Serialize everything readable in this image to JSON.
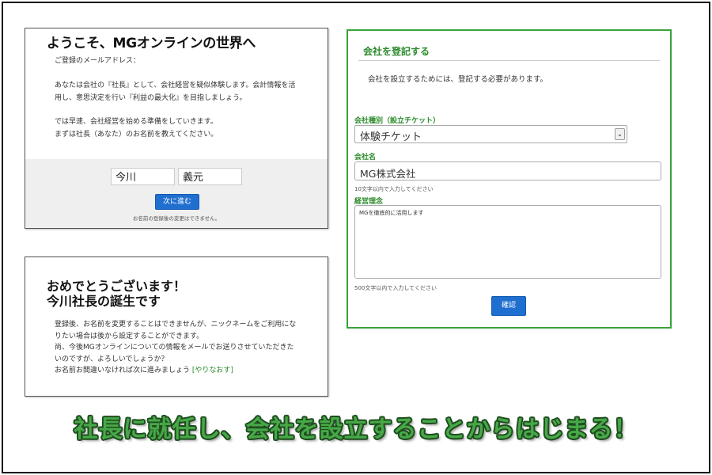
{
  "colors": {
    "accent_green": "#2a8a2a",
    "button_blue": "#1f6fd0",
    "caption_green": "#47a847",
    "caption_outline": "#1f4d1f"
  },
  "welcome": {
    "title": "ようこそ、MGオンラインの世界へ",
    "email_label": "ご登録のメールアドレス：",
    "intro_line1": "あなたは会社の『社長』として、会社経営を疑似体験します。会計情報を活",
    "intro_line2": "用し、意思決定を行い『利益の最大化』を目指しましょう。",
    "prep_line1": "では早速、会社経営を始める準備をしていきます。",
    "prep_line2": "まずは社長（あなた）のお名前を教えてください。",
    "last_name": "今川",
    "first_name": "義元",
    "next_label": "次に進む",
    "name_note": "お名前の登録後の変更はできません。"
  },
  "congrats": {
    "title_line1": "おめでとうございます！",
    "title_line2": "今川社長の誕生です",
    "line1": "登録後、お名前を変更することはできませんが、ニックネームをご利用にな",
    "line2": "りたい場合は後から設定することができます。",
    "line3": "尚、今後MGオンラインについての情報をメールでお送りさせていただきた",
    "line4": "いのですが、よろしいでしょうか？",
    "line5_prefix": "お名前お間違いなければ次に進みましょう",
    "redo_link": "[やりなおす]"
  },
  "company": {
    "heading": "会社を登記する",
    "intro": "会社を設立するためには、登記する必要があります。",
    "type_label": "会社種別（設立チケット）",
    "type_value": "体験チケット",
    "name_label": "会社名",
    "name_value": "MG株式会社",
    "name_hint": "10文字以内で入力してください",
    "philosophy_label": "経営理念",
    "philosophy_value": "MGを徹底的に活用します",
    "philosophy_hint": "500文字以内で入力してください",
    "confirm_label": "確認"
  },
  "caption": "社長に就任し、会社を設立することからはじまる！"
}
